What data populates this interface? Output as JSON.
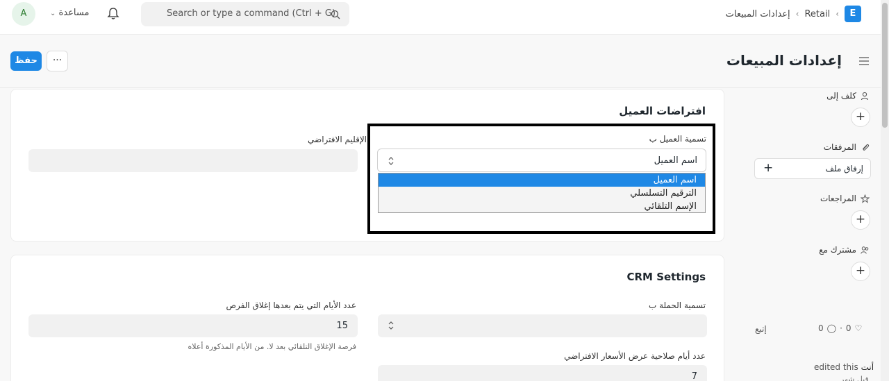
{
  "topbar": {
    "avatar_letter": "A",
    "help_label": "مساعدة",
    "search_placeholder": "Search or type a command (Ctrl + G)",
    "logo_letter": "E",
    "breadcrumb": [
      "Retail",
      "إعدادات المبيعات"
    ]
  },
  "page": {
    "title": "إعدادات المبيعات",
    "save_label": "حفظ",
    "more_label": "···"
  },
  "customer_defaults": {
    "title": "افتراضات العميل",
    "naming_label": "تسمية العميل ب",
    "naming_value": "اسم العميل",
    "naming_options": [
      "اسم العميل",
      "الترقيم التسلسلي",
      "الإسم التلقائي"
    ],
    "territory_label": "الإقليم الافتراضي",
    "territory_value": ""
  },
  "crm": {
    "title": "CRM Settings",
    "campaign_naming_label": "تسمية الحملة ب",
    "campaign_naming_value": "",
    "close_days_label": "عدد الأيام التي يتم بعدها إغلاق الفرص",
    "close_days_value": "15",
    "close_days_hint": "فرصة الإغلاق التلقائي بعد لا. من الأيام المذكورة أعلاه",
    "quote_validity_label": "عدد أيام صلاحية عرض الأسعار الافتراضي",
    "quote_validity_value": "7"
  },
  "sidebar": {
    "assign_label": "كلف إلى",
    "attachments_label": "المرفقات",
    "attach_file_label": "إرفاق ملف",
    "reviews_label": "المراجعات",
    "shared_label": "مشترك مع",
    "likes": "0",
    "comments": "0",
    "follow_label": "إتبع",
    "activity_user": "أنت",
    "activity_text": "edited this",
    "activity_time": "قبل شهر"
  },
  "colors": {
    "primary": "#1e88e5",
    "highlight": "#000000"
  }
}
